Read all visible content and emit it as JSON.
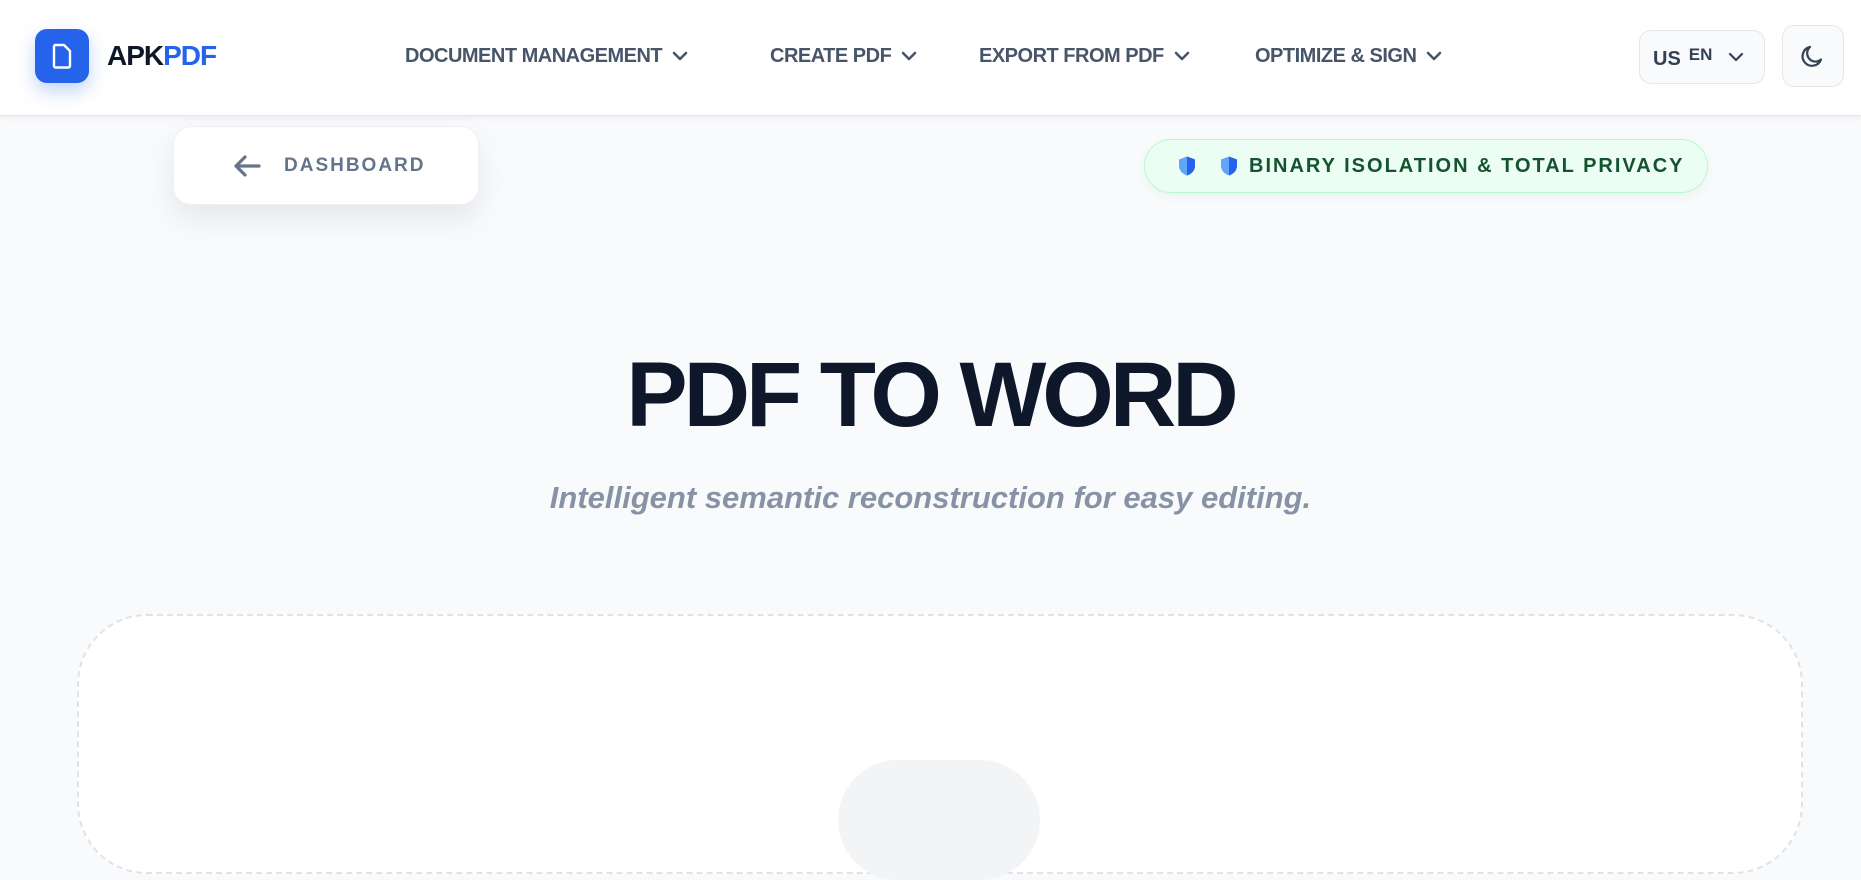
{
  "brand": {
    "name_part1": "APK",
    "name_part2": "PDF",
    "color": "#2563eb"
  },
  "nav": [
    {
      "label": "DOCUMENT MANAGEMENT"
    },
    {
      "label": "CREATE PDF"
    },
    {
      "label": "EXPORT FROM PDF"
    },
    {
      "label": "OPTIMIZE & SIGN"
    }
  ],
  "language": {
    "flag": "US",
    "code": "EN"
  },
  "back_button": {
    "label": "DASHBOARD"
  },
  "privacy_badge": {
    "label": "BINARY ISOLATION & TOTAL PRIVACY"
  },
  "hero": {
    "title": "PDF TO WORD",
    "subtitle": "Intelligent semantic reconstruction for easy editing."
  },
  "colors": {
    "accent": "#2563eb",
    "text_dark": "#0f172a",
    "nav_text": "#475569",
    "privacy_text": "#14532d",
    "privacy_bg": "#ecfdf3"
  }
}
